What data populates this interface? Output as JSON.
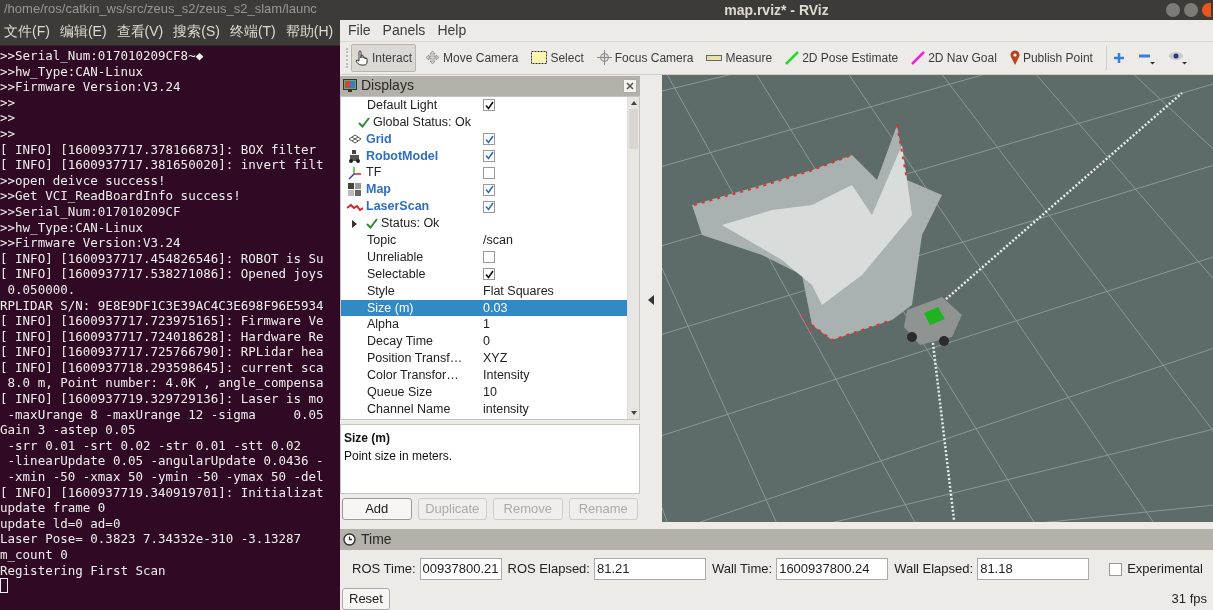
{
  "terminal": {
    "title": "/home/ros/catkin_ws/src/zeus_s2/zeus_s2_slam/launc",
    "menu": [
      "文件(F)",
      "编辑(E)",
      "查看(V)",
      "搜索(S)",
      "终端(T)",
      "帮助(H)"
    ],
    "lines": [
      ">>Serial_Num:017010209CF8~◆",
      ">>hw_Type:CAN-Linux",
      ">>Firmware Version:V3.24",
      ">>",
      ">>",
      ">>",
      "[ INFO] [1600937717.378166873]: BOX filter",
      "[ INFO] [1600937717.381650020]: invert filt",
      ">>open deivce success!",
      ">>Get VCI_ReadBoardInfo success!",
      ">>Serial_Num:017010209CF",
      ">>hw_Type:CAN-Linux",
      ">>Firmware Version:V3.24",
      "[ INFO] [1600937717.454826546]: ROBOT is Su",
      "[ INFO] [1600937717.538271086]: Opened joys",
      " 0.050000.",
      "RPLIDAR S/N: 9E8E9DF1C3E39AC4C3E698F96E5934",
      "[ INFO] [1600937717.723975165]: Firmware Ve",
      "[ INFO] [1600937717.724018628]: Hardware Re",
      "[ INFO] [1600937717.725766790]: RPLidar hea",
      "[ INFO] [1600937718.293598645]: current sca",
      " 8.0 m, Point number: 4.0K , angle_compensa",
      "[ INFO] [1600937719.329729136]: Laser is mo",
      " -maxUrange 8 -maxUrange 12 -sigma     0.05",
      "Gain 3 -astep 0.05",
      " -srr 0.01 -srt 0.02 -str 0.01 -stt 0.02",
      " -linearUpdate 0.05 -angularUpdate 0.0436 -",
      " -xmin -50 -xmax 50 -ymin -50 -ymax 50 -del",
      "[ INFO] [1600937719.340919701]: Initializat",
      "update frame 0",
      "update ld=0 ad=0",
      "Laser Pose= 0.3823 7.34332e-310 -3.13287",
      "m_count 0",
      "Registering First Scan"
    ]
  },
  "rviz": {
    "title": "map.rviz* - RViz",
    "menu": [
      "File",
      "Panels",
      "Help"
    ],
    "tools": [
      {
        "label": "Interact",
        "selected": true
      },
      {
        "label": "Move Camera",
        "selected": false
      },
      {
        "label": "Select",
        "selected": false
      },
      {
        "label": "Focus Camera",
        "selected": false
      },
      {
        "label": "Measure",
        "selected": false
      },
      {
        "label": "2D Pose Estimate",
        "selected": false
      },
      {
        "label": "2D Nav Goal",
        "selected": false
      },
      {
        "label": "Publish Point",
        "selected": false
      }
    ],
    "displays": {
      "title": "Displays",
      "rows": [
        {
          "kind": "property",
          "label": "Default Light",
          "checked": true,
          "selected": false
        },
        {
          "kind": "status",
          "label": "Global Status: Ok",
          "selected": false
        },
        {
          "kind": "display",
          "label": "Grid",
          "checked": true,
          "selected": false
        },
        {
          "kind": "display",
          "label": "RobotModel",
          "checked": true,
          "selected": false
        },
        {
          "kind": "display",
          "label": "TF",
          "checked": false,
          "selected": false
        },
        {
          "kind": "display",
          "label": "Map",
          "checked": true,
          "selected": false
        },
        {
          "kind": "display",
          "label": "LaserScan",
          "checked": true,
          "selected": false
        },
        {
          "kind": "status",
          "label": "Status: Ok",
          "expanded": false,
          "selected": false
        },
        {
          "kind": "property",
          "label": "Topic",
          "value": "/scan",
          "selected": false
        },
        {
          "kind": "property",
          "label": "Unreliable",
          "checked": false,
          "selected": false
        },
        {
          "kind": "property",
          "label": "Selectable",
          "checked": true,
          "selected": false
        },
        {
          "kind": "property",
          "label": "Style",
          "value": "Flat Squares",
          "selected": false
        },
        {
          "kind": "property",
          "label": "Size (m)",
          "value": "0.03",
          "selected": true
        },
        {
          "kind": "property",
          "label": "Alpha",
          "value": "1",
          "selected": false
        },
        {
          "kind": "property",
          "label": "Decay Time",
          "value": "0",
          "selected": false
        },
        {
          "kind": "property",
          "label": "Position Transf…",
          "value": "XYZ",
          "selected": false
        },
        {
          "kind": "property",
          "label": "Color Transfor…",
          "value": "Intensity",
          "selected": false
        },
        {
          "kind": "property",
          "label": "Queue Size",
          "value": "10",
          "selected": false
        },
        {
          "kind": "property",
          "label": "Channel Name",
          "value": "intensity",
          "selected": false
        }
      ],
      "description": {
        "title": "Size (m)",
        "text": "Point size in meters."
      },
      "buttons": [
        {
          "label": "Add",
          "disabled": false
        },
        {
          "label": "Duplicate",
          "disabled": true
        },
        {
          "label": "Remove",
          "disabled": true
        },
        {
          "label": "Rename",
          "disabled": true
        }
      ]
    },
    "time": {
      "title": "Time",
      "fields": [
        {
          "label": "ROS Time:",
          "value": "00937800.21"
        },
        {
          "label": "ROS Elapsed:",
          "value": "81.21"
        },
        {
          "label": "Wall Time:",
          "value": "1600937800.24"
        },
        {
          "label": "Wall Elapsed:",
          "value": "81.18"
        }
      ],
      "experimental": {
        "label": "Experimental",
        "checked": false
      },
      "reset": "Reset",
      "fps": "31 fps"
    }
  }
}
